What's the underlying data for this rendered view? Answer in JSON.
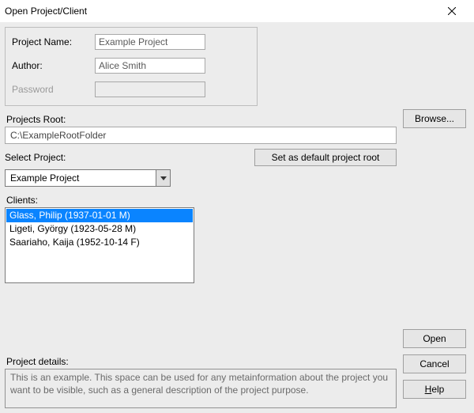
{
  "window": {
    "title": "Open Project/Client"
  },
  "fields": {
    "project_name_label": "Project Name:",
    "project_name_value": "Example Project",
    "author_label": "Author:",
    "author_value": "Alice Smith",
    "password_label": "Password",
    "password_value": ""
  },
  "root": {
    "label": "Projects Root:",
    "value": "C:\\ExampleRootFolder",
    "browse_label": "Browse..."
  },
  "select": {
    "label": "Select Project:",
    "default_root_label": "Set as default project root",
    "current": "Example Project"
  },
  "clients": {
    "label": "Clients:",
    "items": [
      "Glass, Philip (1937-01-01 M)",
      "Ligeti, György (1923-05-28 M)",
      "Saariaho, Kaija (1952-10-14 F)"
    ]
  },
  "details": {
    "label": "Project details:",
    "text": "This is an example. This space can be used for any metainformation about the project you want to be visible, such as a general description of the project purpose."
  },
  "buttons": {
    "open": "Open",
    "cancel": "Cancel",
    "help": "Help"
  }
}
